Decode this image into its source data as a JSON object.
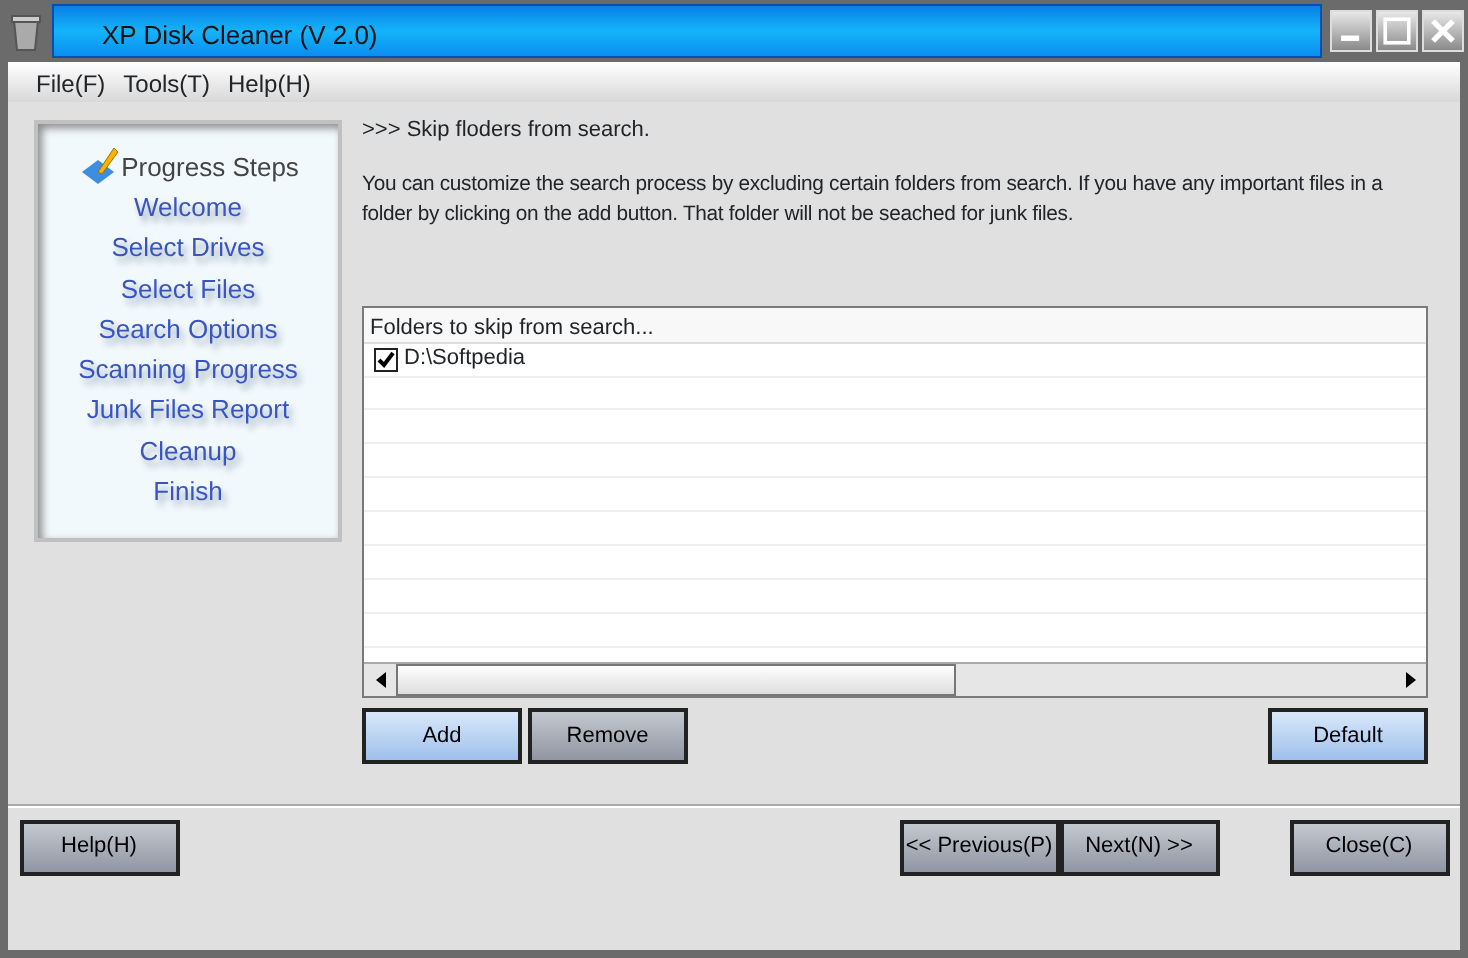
{
  "window": {
    "title": "XP Disk Cleaner (V 2.0)"
  },
  "menu": [
    "File(F)",
    "Tools(T)",
    "Help(H)"
  ],
  "steps": {
    "title": "Progress Steps",
    "items": [
      "Welcome",
      "Select Drives",
      "Select Files",
      "Search Options",
      "Scanning Progress",
      "Junk Files Report",
      "Cleanup",
      "Finish"
    ]
  },
  "heading": ">>> Skip floders from search.",
  "description": "You can customize the search process by excluding certain folders from search. If you have any important files in a folder by clicking on the add button. That folder will not be seached for junk files.",
  "folder_list": {
    "header": "Folders to skip from search...",
    "items": [
      {
        "label": "D:\\Softpedia",
        "checked": true
      }
    ]
  },
  "list_buttons": [
    {
      "label": "Add",
      "kind": "blue"
    },
    {
      "label": "Remove",
      "kind": "grey"
    }
  ],
  "default_button": {
    "label": "Default",
    "kind": "blue"
  },
  "footer": {
    "help": {
      "label": "Help(H)",
      "kind": "grey"
    },
    "nav": [
      {
        "label": "<< Previous(P)",
        "kind": "grey"
      },
      {
        "label": "Next(N) >>",
        "kind": "grey"
      }
    ],
    "close": {
      "label": "Close(C)",
      "kind": "grey"
    }
  }
}
